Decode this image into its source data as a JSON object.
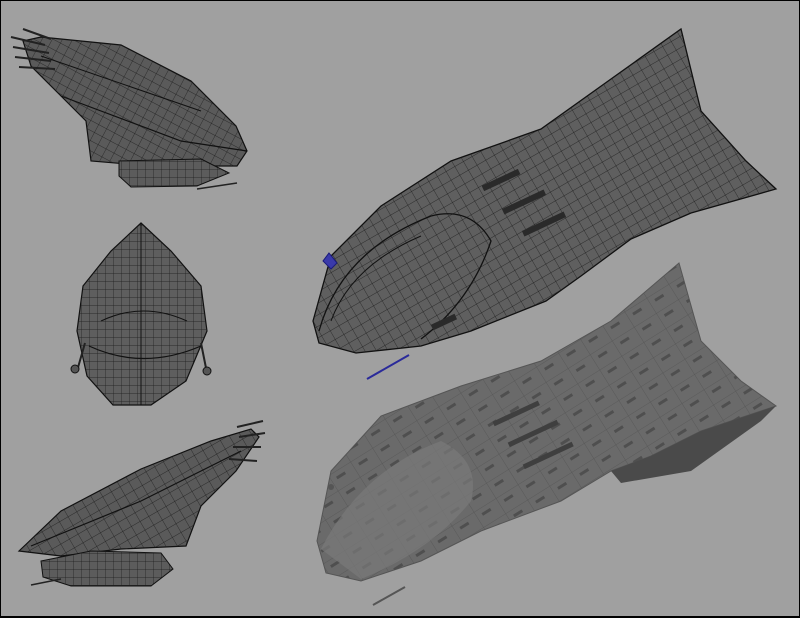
{
  "canvas": {
    "background": "#a0a0a0",
    "border": "#000000"
  },
  "render": {
    "wire_color": "#111111",
    "hull_color": "#6a6a6a",
    "hull_dark": "#4a4a4a",
    "hull_light": "#8a8a8a",
    "selection_color": "#2a2a9a"
  },
  "views": [
    {
      "id": "side-top",
      "mode": "wireframe"
    },
    {
      "id": "front",
      "mode": "wireframe"
    },
    {
      "id": "side-bottom",
      "mode": "wireframe"
    },
    {
      "id": "perspective-wire",
      "mode": "wireframe"
    },
    {
      "id": "perspective-shaded",
      "mode": "shaded"
    }
  ]
}
